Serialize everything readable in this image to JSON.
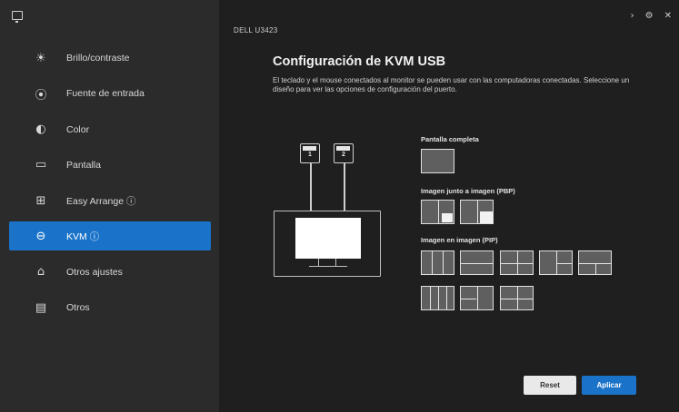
{
  "sidebar": {
    "items": [
      {
        "icon": "brightness-icon",
        "glyph": "☀",
        "label": "Brillo/contraste"
      },
      {
        "icon": "input-source-icon",
        "glyph": "⦿",
        "label": "Fuente de entrada"
      },
      {
        "icon": "color-icon",
        "glyph": "◐",
        "label": "Color"
      },
      {
        "icon": "display-icon",
        "glyph": "▭",
        "label": "Pantalla"
      },
      {
        "icon": "easy-arrange-icon",
        "glyph": "⊞",
        "label": "Easy Arrange ⓘ"
      },
      {
        "icon": "kvm-icon",
        "glyph": "⊖",
        "label": "KVM ⓘ",
        "active": true
      },
      {
        "icon": "others-icon",
        "glyph": "⌂",
        "label": "Otros ajustes"
      },
      {
        "icon": "info-icon",
        "glyph": "▤",
        "label": "Otros"
      }
    ]
  },
  "header": {
    "monitor_name": "DELL U3423",
    "controls": [
      "›",
      "⚙",
      "✕"
    ]
  },
  "main": {
    "title": "Configuración de KVM USB",
    "description": "El teclado y el mouse conectados al monitor se pueden usar con las computadoras conectadas. Seleccione un diseño para ver las opciones de configuración del puerto."
  },
  "diagram": {
    "usb_ports": [
      "1",
      "2"
    ]
  },
  "layouts": {
    "single_label": "Pantalla completa",
    "pbp_label": "Imagen junto a imagen (PBP)",
    "pip_label": "Imagen en imagen (PIP)"
  },
  "buttons": {
    "reset": "Reset",
    "apply": "Aplicar"
  },
  "colors": {
    "accent": "#1a73c9",
    "sidebar_bg": "#2b2b2b",
    "main_bg": "#1f1f1f"
  }
}
